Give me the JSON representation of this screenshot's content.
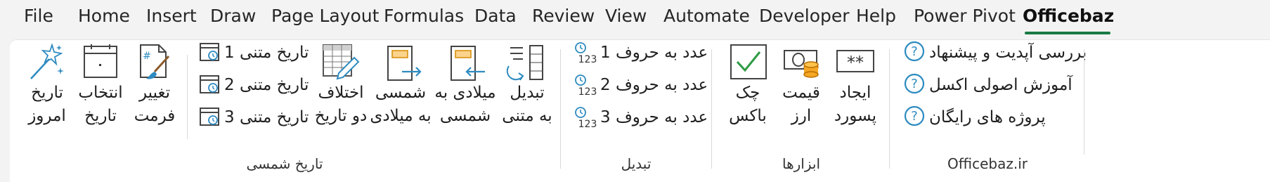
{
  "tabs": [
    "File",
    "Home",
    "Insert",
    "Draw",
    "Page Layout",
    "Formulas",
    "Data",
    "Review",
    "View",
    "Automate",
    "Developer",
    "Help",
    "Power Pivot",
    "Officebaz"
  ],
  "active_tab": "Officebaz",
  "accent_color": "#1a7a45",
  "icon_blue": "#2e8bc0",
  "groups": {
    "officebaz": {
      "label": "Officebaz.ir",
      "items": [
        "بررسی آپدیت و پیشنهاد",
        "آموزش اصولی اکسل",
        "پروژه های رایگان"
      ]
    },
    "tools": {
      "label": "ابزارها",
      "buttons": [
        {
          "line1": "ایجاد",
          "line2": "پسورد",
          "icon": "password-icon"
        },
        {
          "line1": "قیمت",
          "line2": "ارز",
          "icon": "currency-price-icon"
        },
        {
          "line1": "چک",
          "line2": "باکس",
          "icon": "checkbox-icon"
        }
      ]
    },
    "convert": {
      "label": "تبدیل",
      "items": [
        "عدد به حروف 1",
        "عدد به حروف 2",
        "عدد به حروف 3"
      ]
    },
    "shamsi_date": {
      "label": "تاریخ شمسی",
      "buttons": [
        {
          "line1": "تبدیل",
          "line2": "به متنی",
          "icon": "convert-to-text-icon"
        },
        {
          "line1": "میلادی به",
          "line2": "شمسی",
          "icon": "gregorian-to-shamsi-icon"
        },
        {
          "line1": "شمسی",
          "line2": "به میلادی",
          "icon": "shamsi-to-gregorian-icon"
        },
        {
          "line1": "اختلاف",
          "line2": "دو تاریخ",
          "icon": "date-difference-icon"
        }
      ],
      "text_dates": [
        "تاریخ متنی 1",
        "تاریخ متنی 2",
        "تاریخ متنی 3"
      ],
      "small_buttons": [
        {
          "line1": "تغییر",
          "line2": "فرمت",
          "icon": "format-brush-icon"
        },
        {
          "line1": "انتخاب",
          "line2": "تاریخ",
          "icon": "calendar-icon"
        },
        {
          "line1": "تاریخ",
          "line2": "امروز",
          "icon": "magic-wand-icon"
        }
      ]
    }
  }
}
